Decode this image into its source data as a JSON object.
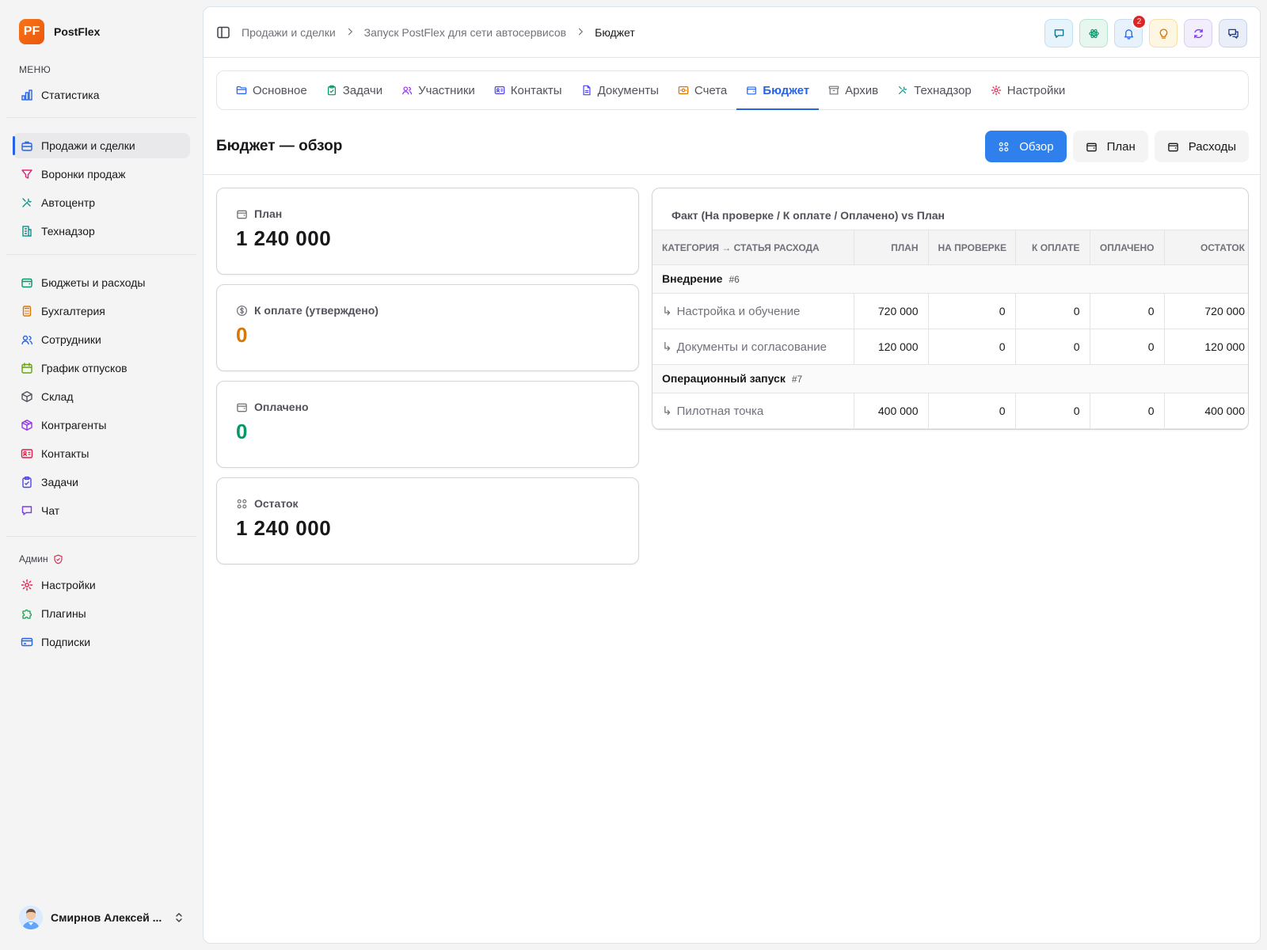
{
  "brand": {
    "logo": "PF",
    "name": "PostFlex",
    "color": "#f97316"
  },
  "sidebar": {
    "menu_label": "МЕНЮ",
    "group1": [
      {
        "label": "Статистика",
        "icon": "bar-chart-icon"
      }
    ],
    "group2": [
      {
        "label": "Продажи и сделки",
        "icon": "briefcase-icon",
        "active": true
      },
      {
        "label": "Воронки продаж",
        "icon": "funnel-icon"
      },
      {
        "label": "Автоцентр",
        "icon": "wrench-icon"
      },
      {
        "label": "Технадзор",
        "icon": "building-icon"
      }
    ],
    "group3": [
      {
        "label": "Бюджеты и расходы",
        "icon": "wallet-icon"
      },
      {
        "label": "Бухгалтерия",
        "icon": "calculator-icon"
      },
      {
        "label": "Сотрудники",
        "icon": "users-icon"
      },
      {
        "label": "График отпусков",
        "icon": "calendar-icon"
      },
      {
        "label": "Склад",
        "icon": "box-icon"
      },
      {
        "label": "Контрагенты",
        "icon": "package-icon"
      },
      {
        "label": "Контакты",
        "icon": "contact-card-icon"
      },
      {
        "label": "Задачи",
        "icon": "clipboard-icon"
      },
      {
        "label": "Чат",
        "icon": "chat-icon"
      }
    ],
    "admin_label": "Админ",
    "admin": [
      {
        "label": "Настройки",
        "icon": "gear-icon"
      },
      {
        "label": "Плагины",
        "icon": "puzzle-icon"
      },
      {
        "label": "Подписки",
        "icon": "credit-card-icon"
      }
    ],
    "user": {
      "name": "Смирнов Алексей ..."
    }
  },
  "breadcrumb": [
    "Продажи и сделки",
    "Запуск PostFlex для сети автосервисов",
    "Бюджет"
  ],
  "top_actions": [
    {
      "icon": "chat-icon",
      "bg": "#e8f4fb",
      "border": "#bfe0f2",
      "color": "#0e7490"
    },
    {
      "icon": "atom-icon",
      "bg": "#e7f7ef",
      "border": "#b7e4cc",
      "color": "#059669"
    },
    {
      "icon": "bell-icon",
      "bg": "#e8f2fc",
      "border": "#c6dcf5",
      "color": "#2563eb",
      "badge": "2"
    },
    {
      "icon": "lightbulb-icon",
      "bg": "#fdf6e3",
      "border": "#f5dfa6",
      "color": "#d97706"
    },
    {
      "icon": "refresh-icon",
      "bg": "#f3eefc",
      "border": "#dccdf7",
      "color": "#7c3aed"
    },
    {
      "icon": "messages-icon",
      "bg": "#e9eef8",
      "border": "#c7d3ea",
      "color": "#1e3a8a"
    }
  ],
  "tabs": [
    {
      "label": "Основное",
      "icon": "folder-icon",
      "color": "#2563eb"
    },
    {
      "label": "Задачи",
      "icon": "clipboard-icon",
      "color": "#059669"
    },
    {
      "label": "Участники",
      "icon": "users-icon",
      "color": "#9333ea"
    },
    {
      "label": "Контакты",
      "icon": "contact-card-icon",
      "color": "#4f46e5"
    },
    {
      "label": "Документы",
      "icon": "file-icon",
      "color": "#4f46e5"
    },
    {
      "label": "Счета",
      "icon": "invoice-icon",
      "color": "#d97706"
    },
    {
      "label": "Бюджет",
      "icon": "wallet-icon",
      "color": "#2563eb",
      "active": true
    },
    {
      "label": "Архив",
      "icon": "archive-icon",
      "color": "#71717a"
    },
    {
      "label": "Технадзор",
      "icon": "wrench-icon",
      "color": "#0d9488"
    },
    {
      "label": "Настройки",
      "icon": "gear-icon",
      "color": "#e11d48"
    }
  ],
  "page": {
    "title": "Бюджет — обзор",
    "views": [
      {
        "label": "Обзор",
        "icon": "grid-icon",
        "active": true
      },
      {
        "label": "План",
        "icon": "wallet-icon"
      },
      {
        "label": "Расходы",
        "icon": "wallet-icon"
      }
    ]
  },
  "summary": [
    {
      "label": "План",
      "value": "1 240 000",
      "icon": "wallet-icon",
      "tone": ""
    },
    {
      "label": "К оплате (утверждено)",
      "value": "0",
      "icon": "dollar-icon",
      "tone": "orange"
    },
    {
      "label": "Оплачено",
      "value": "0",
      "icon": "wallet-icon",
      "tone": "green"
    },
    {
      "label": "Остаток",
      "value": "1 240 000",
      "icon": "grid-icon",
      "tone": ""
    }
  ],
  "table": {
    "title": "Факт (На проверке / К оплате / Оплачено) vs План",
    "columns": [
      "КАТЕГОРИЯ → СТАТЬЯ РАСХОДА",
      "ПЛАН",
      "НА ПРОВЕРКЕ",
      "К ОПЛАТЕ",
      "ОПЛАЧЕНО",
      "ОСТАТОК"
    ],
    "groups": [
      {
        "name": "Внедрение",
        "num": "#6",
        "rows": [
          {
            "item": "Настройка и обучение",
            "plan": "720 000",
            "review": "0",
            "to_pay": "0",
            "paid": "0",
            "rest": "720 000"
          },
          {
            "item": "Документы и согласование",
            "plan": "120 000",
            "review": "0",
            "to_pay": "0",
            "paid": "0",
            "rest": "120 000"
          }
        ]
      },
      {
        "name": "Операционный запуск",
        "num": "#7",
        "rows": [
          {
            "item": "Пилотная точка",
            "plan": "400 000",
            "review": "0",
            "to_pay": "0",
            "paid": "0",
            "rest": "400 000"
          }
        ]
      }
    ]
  }
}
